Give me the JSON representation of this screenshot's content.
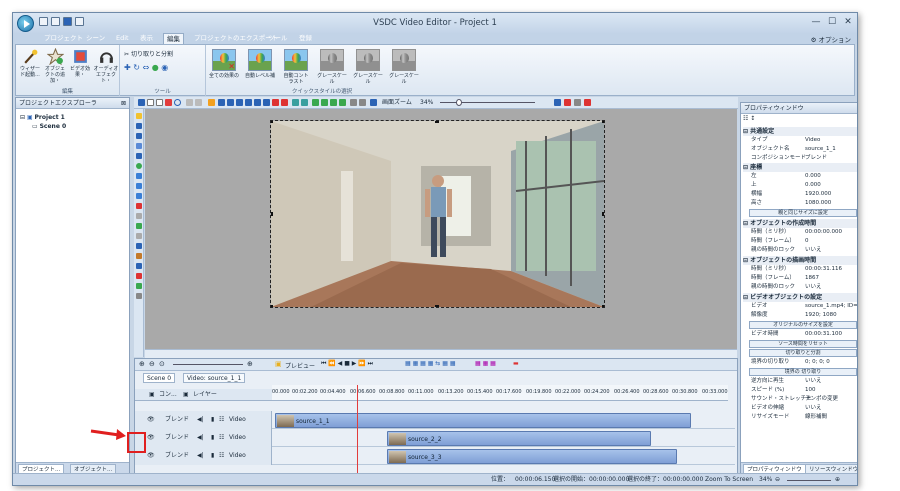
{
  "window": {
    "title": "VSDC Video Editor - Project 1",
    "min": "—",
    "max": "☐",
    "close": "✕"
  },
  "menus": [
    "プロジェクト",
    "シーン",
    "Edit",
    "表示",
    "編集",
    "プロジェクトのエクスポート",
    "ツール",
    "登録"
  ],
  "active_menu": "編集",
  "options_label": "⚙ オプション",
  "ribbon": {
    "edit_group": {
      "label": "編集",
      "buttons": [
        "ウィザード起動...",
        "オブジェクトの追加・",
        "ビデオ効果・",
        "オーディオエフェクト・"
      ]
    },
    "tools_group": {
      "label": "ツール",
      "cut_label": "切り取りと分割"
    },
    "quickstyles_group": {
      "label": "クイックスタイルの選択",
      "thumbs": [
        "全ての効果の",
        "自動レベル補",
        "自動コントラスト",
        "グレースケール",
        "グレースケール",
        "グレースケール"
      ]
    }
  },
  "project_explorer": {
    "title": "プロジェクトエクスプローラ",
    "pin": "⊠",
    "project": "Project 1",
    "scene": "Scene 0"
  },
  "left_tabs": [
    "プロジェクト...",
    "オブジェクト..."
  ],
  "editor_toolbar": {
    "zoom_label": "画面ズーム",
    "zoom_value": "34%"
  },
  "timeline": {
    "scene_tab": "Scene 0",
    "video_tab": "Video: source_1_1",
    "preview_label": "プレビュー",
    "header_com": "コン...",
    "header_layer": "レイヤー",
    "ruler": [
      "00.000",
      "00:02.200",
      "00:04.400",
      "00:06.600",
      "00:08.800",
      "00:11.000",
      "00:13.200",
      "00:15.400",
      "00:17.600",
      "00:19.800",
      "00:22.000",
      "00:24.200",
      "00:26.400",
      "00:28.600",
      "00:30.800",
      "00:33.000"
    ],
    "tracks": [
      {
        "blend": "ブレンド",
        "type": "Video",
        "clip": "source_1_1"
      },
      {
        "blend": "ブレンド",
        "type": "Video",
        "clip": "source_2_2"
      },
      {
        "blend": "ブレンド",
        "type": "Video",
        "clip": "source_3_3"
      }
    ]
  },
  "properties": {
    "title": "プロパティウィンドウ",
    "sections": {
      "common": "共通設定",
      "coords": "座標",
      "creation": "オブジェクトの作成時間",
      "drawing": "オブジェクトの描画時間",
      "video_settings": "ビデオオブジェクトの設定"
    },
    "rows": {
      "type": [
        "タイプ",
        "Video"
      ],
      "name": [
        "オブジェクト名",
        "source_1_1"
      ],
      "comp": [
        "コンポジションモード",
        "ブレンド"
      ],
      "left": [
        "左",
        "0.000"
      ],
      "top": [
        "上",
        "0.000"
      ],
      "width": [
        "横幅",
        "1920.000"
      ],
      "height": [
        "高さ",
        "1080.000"
      ],
      "c_ms": [
        "時間（ミリ秒）",
        "00:00:00.000"
      ],
      "c_fr": [
        "時間（フレーム）",
        "0"
      ],
      "c_lock": [
        "親の時間のロック",
        "いいえ"
      ],
      "d_ms": [
        "時間（ミリ秒）",
        "00:00:31.116"
      ],
      "d_fr": [
        "時間（フレーム）",
        "1867"
      ],
      "d_lock": [
        "親の時間のロック",
        "いいえ"
      ],
      "video": [
        "ビデオ",
        "source_1.mp4; ID="
      ],
      "res": [
        "解像度",
        "1920; 1080"
      ],
      "vtime": [
        "ビデオ時間",
        "00:00:31.100"
      ],
      "trim": [
        "境界の切り取り",
        "0; 0; 0; 0"
      ],
      "reverse": [
        "逆方向に再生",
        "いいえ"
      ],
      "speed": [
        "スピード (%)",
        "100"
      ],
      "stretch": [
        "サウンド・ストレッチモ",
        "テンポの変更"
      ],
      "vstretch": [
        "ビデオの伸縮",
        "いいえ"
      ],
      "resize": [
        "リサイズモード",
        "線形補間"
      ]
    },
    "buttons": {
      "parent_size": "親と同じサイズに設定",
      "orig_size": "オリジナルのサイズを設定",
      "reset_time": "ソース時間をリセット",
      "cut_split": "切り取りと分割",
      "trim_btn": "境界の 切り取り"
    },
    "tabs": [
      "プロパティウィンドウ",
      "リソースウィンドウ"
    ]
  },
  "status": {
    "position": "位置：",
    "pos_val": "00:00:06.150",
    "sel_start": "選択の開始：",
    "sel_start_val": "00:00:00.000",
    "sel_end": "選択の終了：",
    "sel_end_val": "00:00:00.000",
    "zoom_label": "Zoom To Screen",
    "zoom_val": "34%"
  }
}
